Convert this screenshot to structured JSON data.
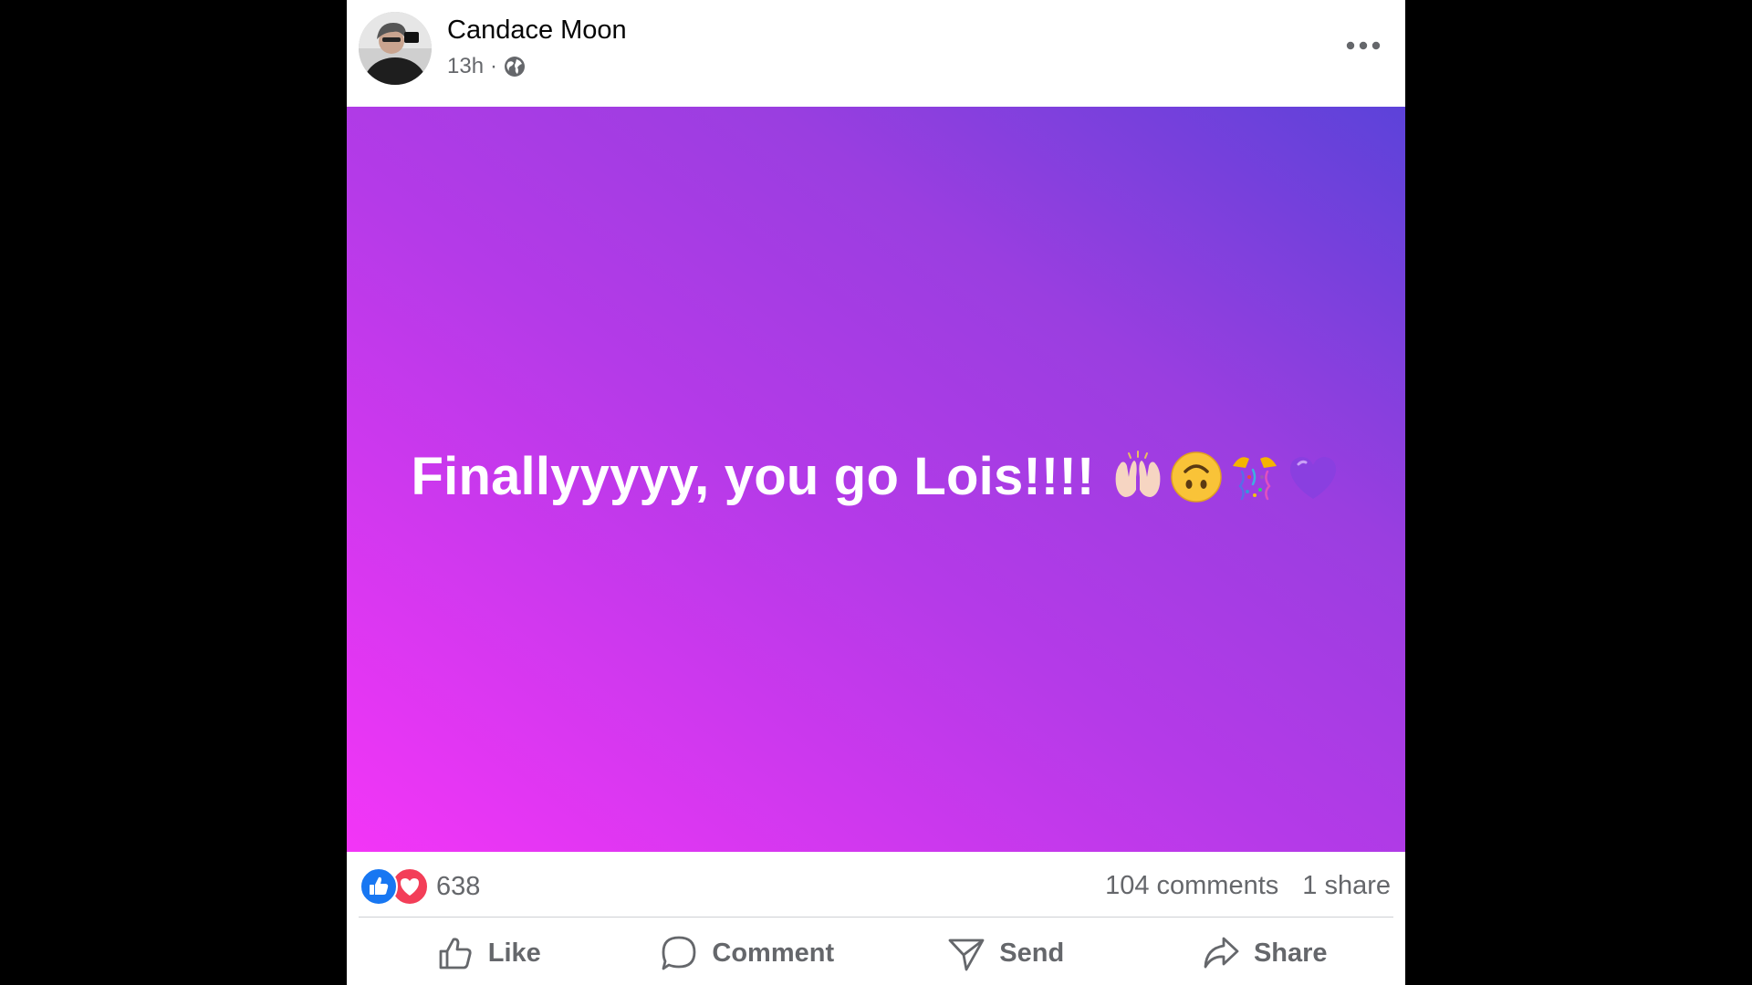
{
  "post": {
    "author_name": "Candace Moon",
    "timestamp": "13h",
    "meta_separator": "·",
    "privacy_icon": "globe-icon",
    "more_icon": "more-options-icon",
    "status_text": "Finallyyyyy, you go Lois!!!!",
    "emojis": [
      "raising-hands-emoji",
      "upside-down-face-emoji",
      "confetti-emoji",
      "purple-heart-emoji"
    ],
    "background_gradient": [
      "#f335f7",
      "#b53ae8",
      "#5c42d9"
    ]
  },
  "reactions": {
    "icons": [
      "like-reaction-icon",
      "love-reaction-icon"
    ],
    "count": "638",
    "comments": "104 comments",
    "shares": "1 share"
  },
  "actions": [
    {
      "label": "Like",
      "icon": "thumbs-up-icon"
    },
    {
      "label": "Comment",
      "icon": "comment-icon"
    },
    {
      "label": "Send",
      "icon": "send-icon"
    },
    {
      "label": "Share",
      "icon": "share-icon"
    }
  ],
  "colors": {
    "like_blue": "#1877f2",
    "love_red": "#f33e58",
    "secondary_text": "#65676b"
  }
}
